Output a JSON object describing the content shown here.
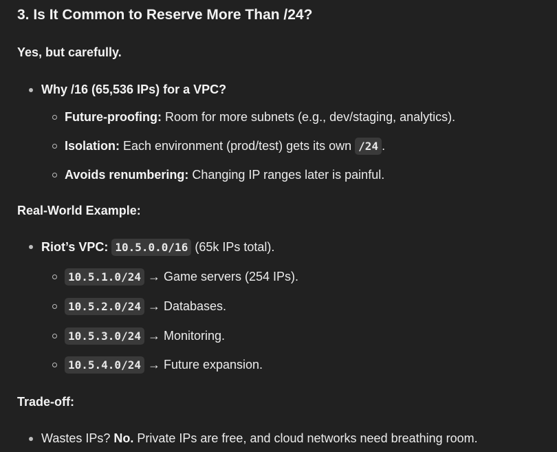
{
  "heading": "3. Is It Common to Reserve More Than /24?",
  "intro": "Yes, but carefully.",
  "why": {
    "label": "Why /16 (65,536 IPs) for a VPC?",
    "items": [
      {
        "bold": "Future-proofing:",
        "text": " Room for more subnets (e.g., dev/staging, analytics)."
      },
      {
        "bold": "Isolation:",
        "text": " Each environment (prod/test) gets its own ",
        "code": "/24",
        "after": "."
      },
      {
        "bold": "Avoids renumbering:",
        "text": " Changing IP ranges later is painful."
      }
    ]
  },
  "example": {
    "heading": "Real-World Example:",
    "vpc_bold": "Riot’s VPC:",
    "vpc_code": "10.5.0.0/16",
    "vpc_after": " (65k IPs total).",
    "subnets": [
      {
        "code": "10.5.1.0/24",
        "text": " → Game servers (254 IPs)."
      },
      {
        "code": "10.5.2.0/24",
        "text": " → Databases."
      },
      {
        "code": "10.5.3.0/24",
        "text": " → Monitoring."
      },
      {
        "code": "10.5.4.0/24",
        "text": " → Future expansion."
      }
    ]
  },
  "tradeoff": {
    "heading": "Trade-off:",
    "item_before": "Wastes IPs? ",
    "item_bold": "No.",
    "item_after": " Private IPs are free, and cloud networks need breathing room."
  }
}
